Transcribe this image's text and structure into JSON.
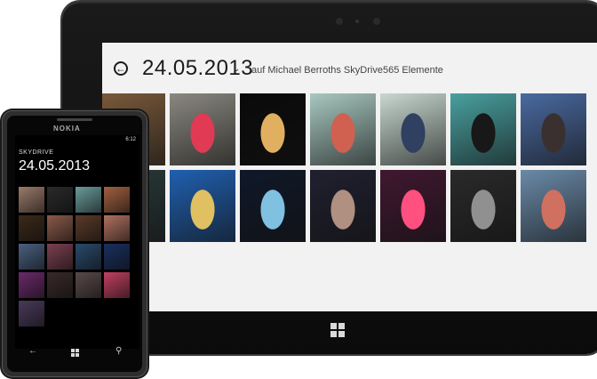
{
  "tablet": {
    "header": {
      "date_title": "24.05.2013",
      "subtitle": "auf Michael Berroths SkyDrive",
      "count": "565 Elemente"
    },
    "photos": [
      {
        "bg": "#7a5a3a",
        "fg": "#d8a070"
      },
      {
        "bg": "#8a8880",
        "fg": "#e03a55"
      },
      {
        "bg": "#0a0a0a",
        "fg": "#e0b060"
      },
      {
        "bg": "#a8c8c0",
        "fg": "#d06050"
      },
      {
        "bg": "#c8d8d0",
        "fg": "#304060"
      },
      {
        "bg": "#4aa0a0",
        "fg": "#181818"
      },
      {
        "bg": "#4a6aa0",
        "fg": "#3a3030"
      },
      {
        "bg": "#2a3a3a",
        "fg": "#c0a080"
      },
      {
        "bg": "#2060b0",
        "fg": "#e0c060"
      },
      {
        "bg": "#101828",
        "fg": "#80c0e0"
      },
      {
        "bg": "#202030",
        "fg": "#b09080"
      },
      {
        "bg": "#401830",
        "fg": "#ff5080"
      },
      {
        "bg": "#2a2a2a",
        "fg": "#909090"
      },
      {
        "bg": "#6a8aa8",
        "fg": "#d07060"
      }
    ]
  },
  "phone": {
    "brand": "NOKIA",
    "time": "6:12",
    "app_title": "SKYDRIVE",
    "date": "24.05.2013",
    "photos": [
      {
        "bg": "#9a7a6a"
      },
      {
        "bg": "#2a2a2a"
      },
      {
        "bg": "#6a9a9a"
      },
      {
        "bg": "#a06040"
      },
      {
        "bg": "#3a2a1a"
      },
      {
        "bg": "#8a5a4a"
      },
      {
        "bg": "#5a3a2a"
      },
      {
        "bg": "#b07060"
      },
      {
        "bg": "#4a6080"
      },
      {
        "bg": "#7a4050"
      },
      {
        "bg": "#2a4a6a"
      },
      {
        "bg": "#1a3060"
      },
      {
        "bg": "#6a2a6a"
      },
      {
        "bg": "#3a2a2a"
      },
      {
        "bg": "#5a4a4a"
      },
      {
        "bg": "#c04060"
      },
      {
        "bg": "#4a3a5a"
      }
    ]
  }
}
